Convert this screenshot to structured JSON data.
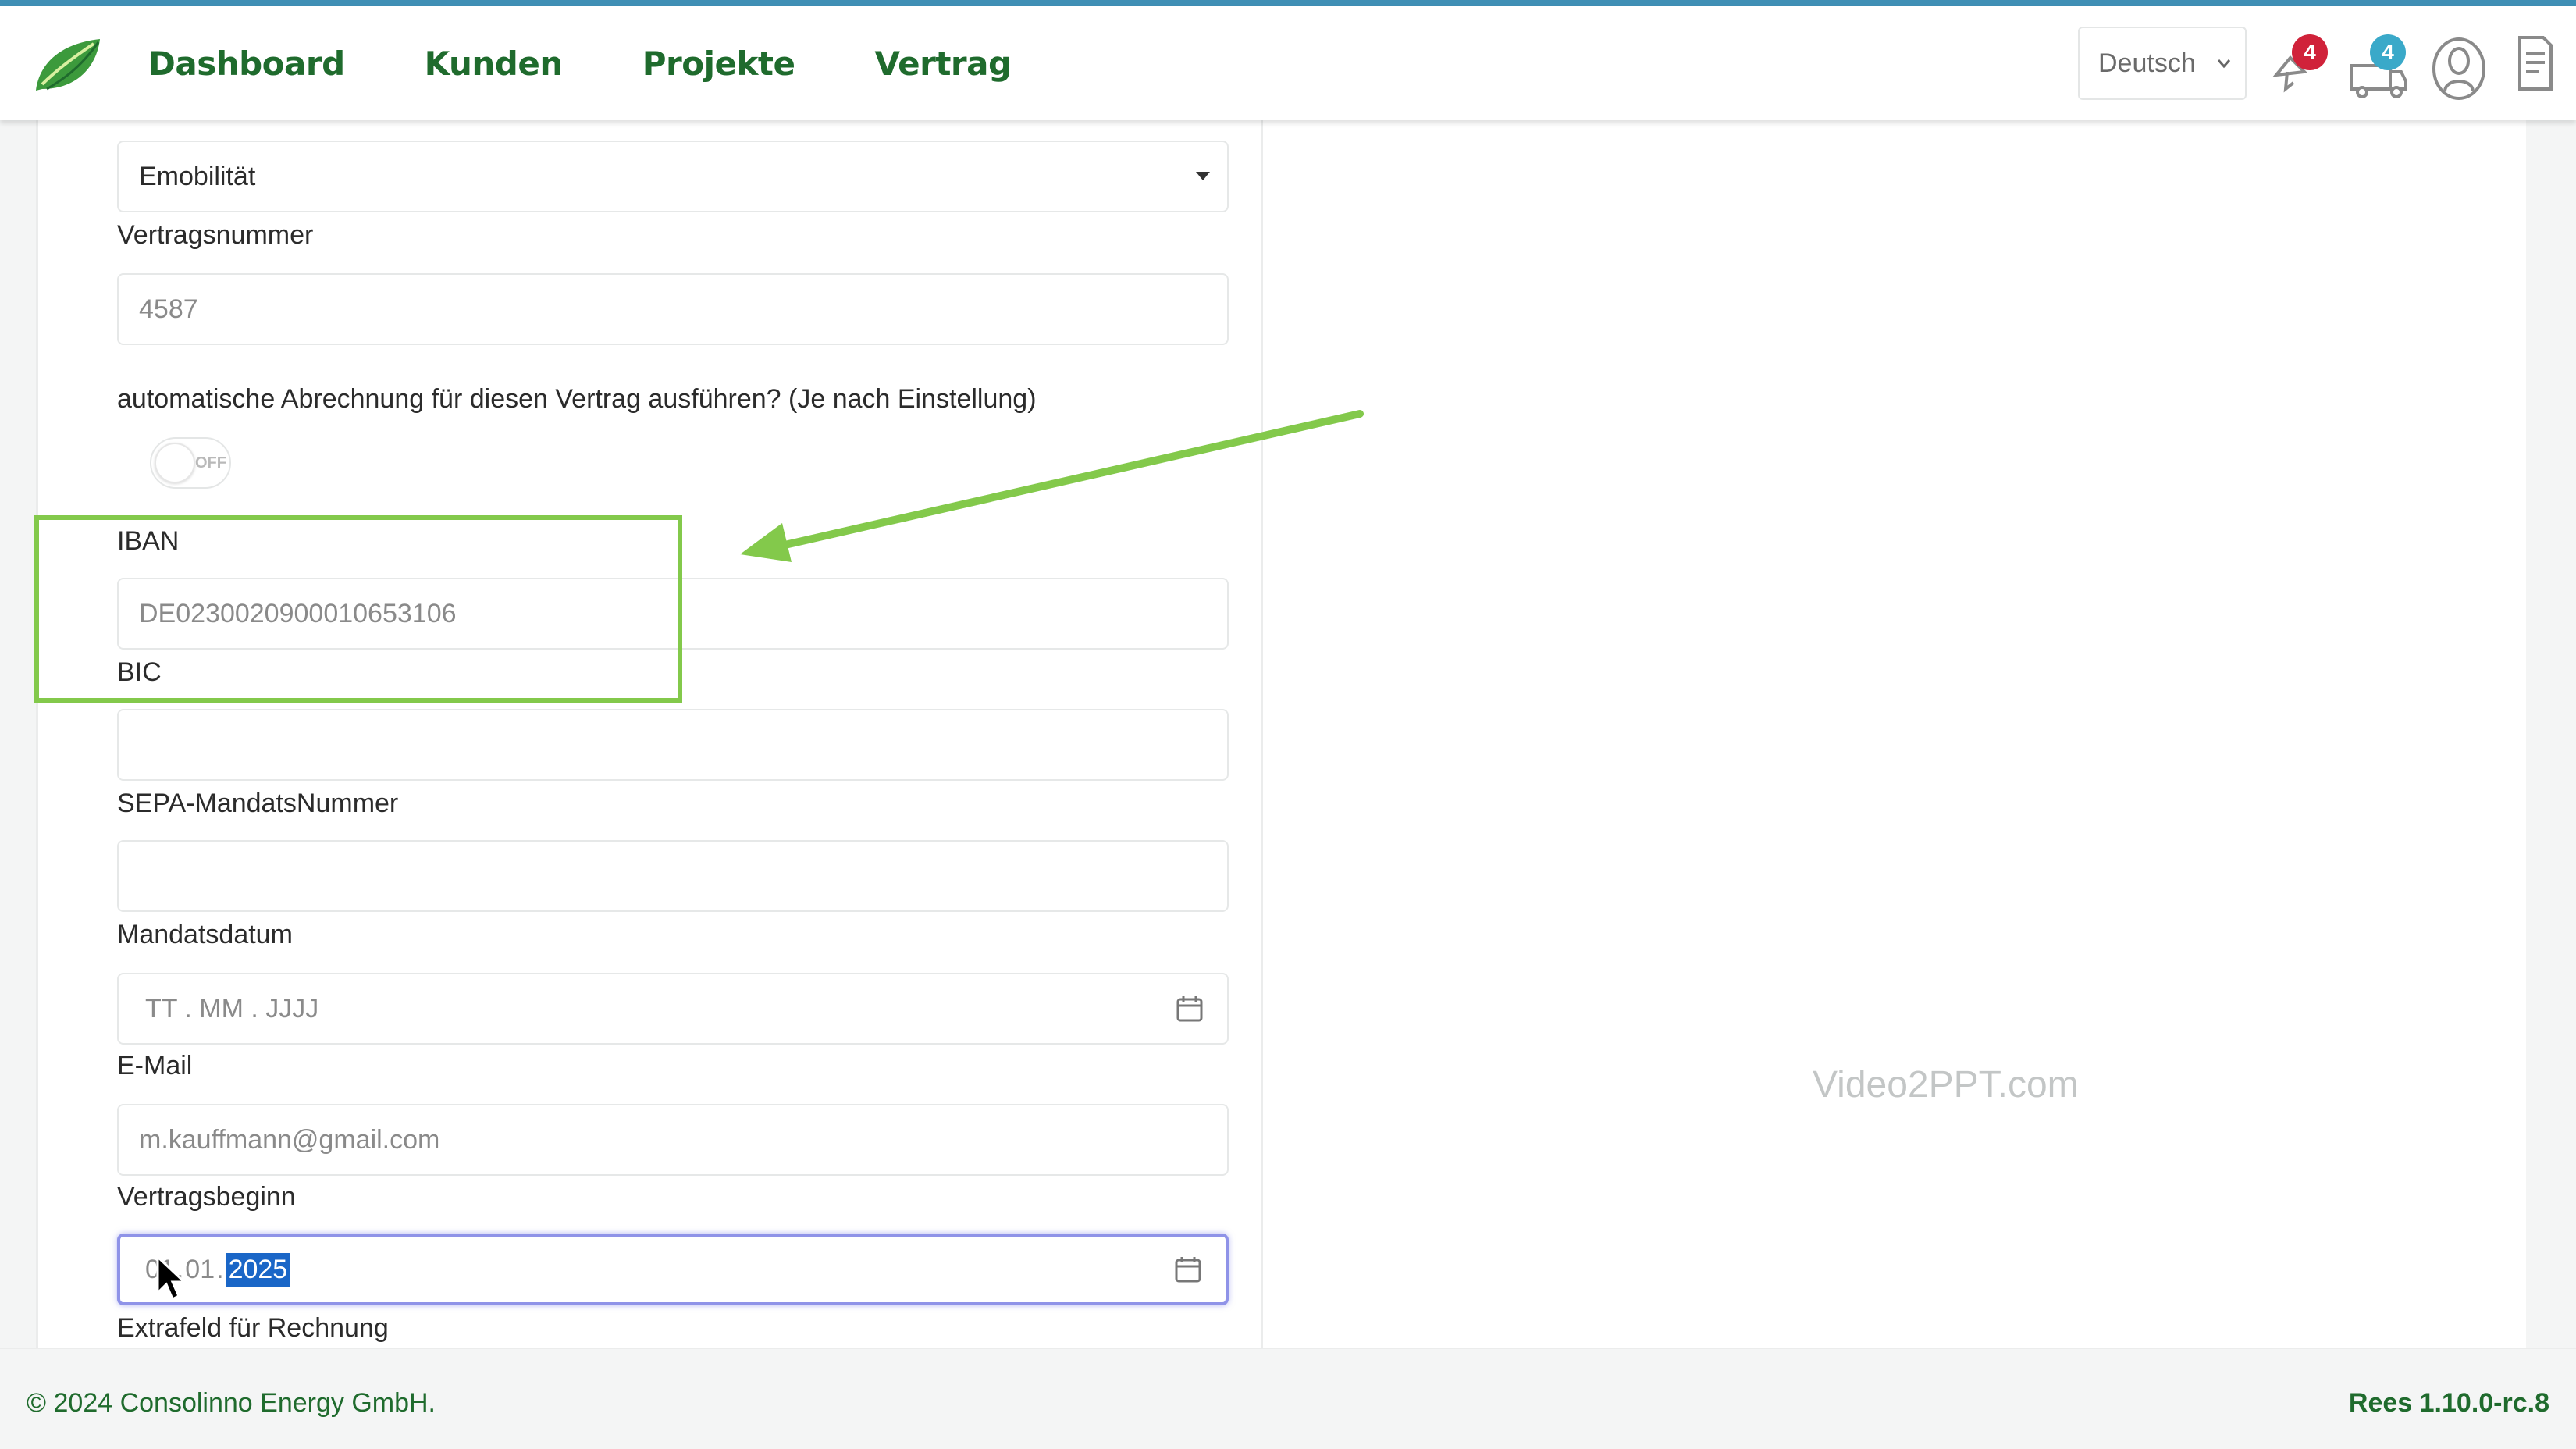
{
  "header": {
    "nav": [
      "Dashboard",
      "Kunden",
      "Projekte",
      "Vertrag"
    ],
    "language": "Deutsch",
    "notification_count": "4",
    "truck_count": "4",
    "brand_color": "#1f6b2d",
    "notification_badge_color": "#d0223a",
    "truck_badge_color": "#3aa9c9"
  },
  "form": {
    "category_value": "Emobilität",
    "contract_number_label": "Vertragsnummer",
    "contract_number_value": "4587",
    "auto_billing_label": "automatische Abrechnung für diesen Vertrag ausführen? (Je nach Einstellung)",
    "toggle_text": "OFF",
    "iban_label": "IBAN",
    "iban_value": "DE023002090001065310­6",
    "bic_label": "BIC",
    "bic_value": "",
    "sepa_label": "SEPA-MandatsNummer",
    "sepa_value": "",
    "mandate_date_label": "Mandatsdatum",
    "mandate_date_placeholder": "TT . MM . JJJJ",
    "email_label": "E-Mail",
    "email_value": "m.kauffmann@gmail.com",
    "contract_start_label": "Vertragsbeginn",
    "contract_start_day": "01",
    "contract_start_month": "01",
    "contract_start_year": "2025",
    "extra_field_label": "Extrafeld für Rechnung"
  },
  "annotation": {
    "highlight_color": "#83c94b"
  },
  "watermark": "Video2PPT.com",
  "footer": {
    "copyright": "© 2024 Consolinno Energy GmbH.",
    "version": "Rees 1.10.0-rc.8"
  }
}
